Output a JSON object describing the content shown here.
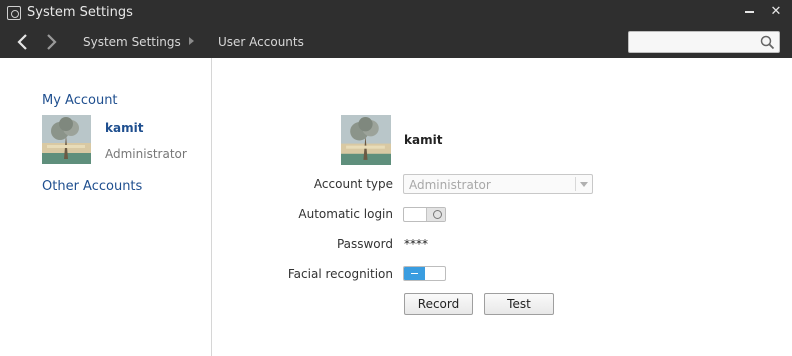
{
  "window": {
    "title": "System Settings",
    "close_glyph": "✕"
  },
  "toolbar": {
    "breadcrumbs": [
      "System Settings",
      "User Accounts"
    ],
    "search": {
      "value": "",
      "placeholder": ""
    }
  },
  "sidebar": {
    "my_account_label": "My Account",
    "user": {
      "name": "kamit",
      "role": "Administrator"
    },
    "other_accounts_label": "Other Accounts"
  },
  "main": {
    "user_name": "kamit",
    "fields": {
      "account_type_label": "Account type",
      "account_type_value": "Administrator",
      "automatic_login_label": "Automatic login",
      "automatic_login_on": false,
      "password_label": "Password",
      "password_value": "****",
      "facial_recognition_label": "Facial recognition",
      "facial_recognition_on": true
    },
    "buttons": {
      "record": "Record",
      "test": "Test"
    }
  },
  "colors": {
    "titlebar_bg": "#2f2f2f",
    "link_blue": "#1f4f8f",
    "toggle_on": "#3a9de0"
  }
}
